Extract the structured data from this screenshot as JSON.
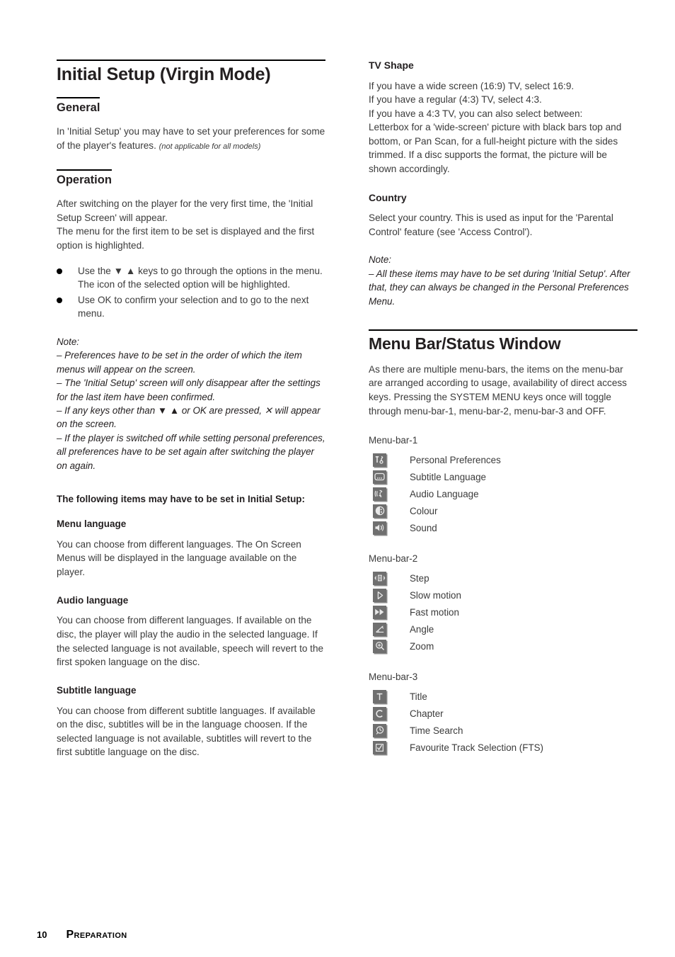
{
  "document": {
    "title": "Initial Setup (Virgin Mode)",
    "footer": {
      "page_number": "10",
      "section": "Preparation"
    }
  },
  "left_column": {
    "title": "Initial Setup (Virgin Mode)",
    "general": {
      "heading": "General",
      "paragraph": "In 'Initial Setup' you may have to set your preferences for some of the player's features.",
      "note_inline": "(not applicable for all models)"
    },
    "operation": {
      "heading": "Operation",
      "paragraph": "After switching on the player for the very first time, the 'Initial Setup Screen' will appear.\nThe menu for the first item to be set is displayed and the first option is highlighted.",
      "bullets": [
        "Use the ▼ ▲ keys to go through the options in the menu. The icon of the selected option will be highlighted.",
        "Use OK to confirm your selection and to go to the next menu."
      ],
      "note_label": "Note:",
      "notes": [
        "–  Preferences have to be set in the order of which the item menus will appear on the screen.",
        "–  The 'Initial Setup' screen will only disappear after the settings for the last item have been confirmed.",
        "–  If any keys other than ▼ ▲ or OK are pressed, ✕ will appear on the screen.",
        "–  If the player is switched off while setting personal preferences, all preferences have to be set again after switching the player on again."
      ]
    },
    "items_intro": "The following items may have to be set in Initial Setup:",
    "sections": [
      {
        "heading": "Menu language",
        "text": "You can choose from different languages. The On Screen Menus will be displayed in the language available on the player."
      },
      {
        "heading": "Audio language",
        "text": "You can choose from different languages. If available on the disc, the player will play the audio in the selected language. If the selected language is not available, speech will revert to the first spoken language on the disc."
      },
      {
        "heading": "Subtitle language",
        "text": "You can choose from different subtitle languages. If available on the disc, subtitles will be in the language choosen. If the selected language is not available, subtitles will revert to the first subtitle language on the disc."
      }
    ]
  },
  "right_column": {
    "tv_shape": {
      "heading": "TV Shape",
      "text": "If you have a wide screen (16:9) TV, select 16:9.\nIf you have a regular (4:3) TV, select 4:3.\nIf you have a 4:3 TV, you can also select between:\nLetterbox for a 'wide-screen' picture with black bars top and bottom, or Pan Scan, for a full-height picture with the sides trimmed. If a disc supports the format, the picture will be shown accordingly."
    },
    "country": {
      "heading": "Country",
      "text": "Select your country. This is used as input for the 'Parental Control' feature (see 'Access Control').",
      "note_label": "Note:",
      "note": "–  All these items may have to be set during 'Initial Setup'. After that, they can always be changed in the Personal Preferences Menu."
    },
    "menu_bar": {
      "title": "Menu Bar/Status Window",
      "intro": "As there are multiple menu-bars, the items on the menu-bar are arranged according to usage, availability of direct access keys. Pressing the SYSTEM MENU keys once will toggle through menu-bar-1, menu-bar-2, menu-bar-3 and OFF.",
      "groups": [
        {
          "label": "Menu-bar-1",
          "items": [
            {
              "icon": "personal-preferences-icon",
              "label": "Personal Preferences"
            },
            {
              "icon": "subtitle-language-icon",
              "label": "Subtitle Language"
            },
            {
              "icon": "audio-language-icon",
              "label": "Audio Language"
            },
            {
              "icon": "colour-icon",
              "label": "Colour"
            },
            {
              "icon": "sound-icon",
              "label": "Sound"
            }
          ]
        },
        {
          "label": "Menu-bar-2",
          "items": [
            {
              "icon": "step-icon",
              "label": "Step"
            },
            {
              "icon": "slow-motion-icon",
              "label": "Slow motion"
            },
            {
              "icon": "fast-motion-icon",
              "label": "Fast motion"
            },
            {
              "icon": "angle-icon",
              "label": "Angle"
            },
            {
              "icon": "zoom-icon",
              "label": "Zoom"
            }
          ]
        },
        {
          "label": "Menu-bar-3",
          "items": [
            {
              "icon": "title-icon",
              "label": "Title"
            },
            {
              "icon": "chapter-icon",
              "label": "Chapter"
            },
            {
              "icon": "time-search-icon",
              "label": "Time Search"
            },
            {
              "icon": "fts-icon",
              "label": "Favourite Track Selection (FTS)"
            }
          ]
        }
      ]
    }
  },
  "colors": {
    "icon_box": "#6f6f6f",
    "icon_glyph": "#e8e8e8",
    "text": "#3b3b3b",
    "rule": "#000000"
  }
}
